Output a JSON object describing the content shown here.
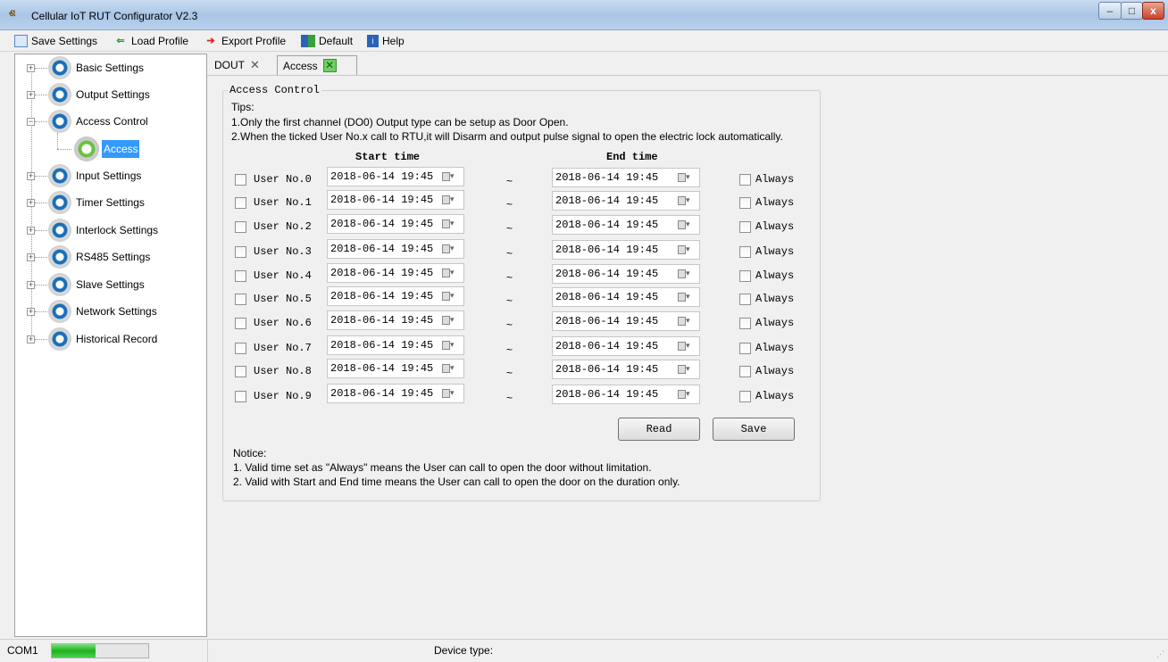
{
  "window": {
    "title": "Cellular IoT RUT Configurator V2.3",
    "min": "–",
    "max": "□",
    "close": "x"
  },
  "menu": [
    {
      "label": "Save Settings",
      "icon": "save-icon"
    },
    {
      "label": "Load Profile",
      "icon": "load-icon"
    },
    {
      "label": "Export Profile",
      "icon": "export-icon"
    },
    {
      "label": "Default",
      "icon": "default-icon"
    },
    {
      "label": "Help",
      "icon": "help-icon"
    }
  ],
  "sidebar": {
    "items": [
      {
        "label": "Basic Settings"
      },
      {
        "label": "Output Settings"
      },
      {
        "label": "Access Control"
      },
      {
        "label": "Access"
      },
      {
        "label": "Input Settings"
      },
      {
        "label": "Timer Settings"
      },
      {
        "label": "Interlock Settings"
      },
      {
        "label": "RS485 Settings"
      },
      {
        "label": "Slave Settings"
      },
      {
        "label": "Network Settings"
      },
      {
        "label": "Historical Record"
      }
    ]
  },
  "tabs": [
    {
      "label": "DOUT",
      "close": "✕"
    },
    {
      "label": "Access",
      "close": "✕"
    }
  ],
  "content": {
    "group_title": "Access Control",
    "tips_title": "Tips:",
    "tip1": "1.Only the first channel (DO0) Output type can be setup as Door Open.",
    "tip2": "2.When the ticked User No.x call to RTU,it will Disarm and output pulse signal to open the electric lock automatically.",
    "start_header": "Start time",
    "end_header": "End time",
    "tilde": "~",
    "always_label": "Always",
    "users": [
      {
        "label": "User No.0",
        "start": "2018-06-14 19:45",
        "end": "2018-06-14 19:45"
      },
      {
        "label": "User No.1",
        "start": "2018-06-14 19:45",
        "end": "2018-06-14 19:45"
      },
      {
        "label": "User No.2",
        "start": "2018-06-14 19:45",
        "end": "2018-06-14 19:45"
      },
      {
        "label": "User No.3",
        "start": "2018-06-14 19:45",
        "end": "2018-06-14 19:45"
      },
      {
        "label": "User No.4",
        "start": "2018-06-14 19:45",
        "end": "2018-06-14 19:45"
      },
      {
        "label": "User No.5",
        "start": "2018-06-14 19:45",
        "end": "2018-06-14 19:45"
      },
      {
        "label": "User No.6",
        "start": "2018-06-14 19:45",
        "end": "2018-06-14 19:45"
      },
      {
        "label": "User No.7",
        "start": "2018-06-14 19:45",
        "end": "2018-06-14 19:45"
      },
      {
        "label": "User No.8",
        "start": "2018-06-14 19:45",
        "end": "2018-06-14 19:45"
      },
      {
        "label": "User No.9",
        "start": "2018-06-14 19:45",
        "end": "2018-06-14 19:45"
      }
    ],
    "read_button": "Read",
    "save_button": "Save",
    "notice_title": "Notice:",
    "notice1": "1. Valid time set as \"Always\" means the User can call to open the door without limitation.",
    "notice2": "2. Valid with Start and End time means the User can call to open the door on the duration only."
  },
  "status": {
    "com_label": "COM1",
    "progress": 0.45,
    "device_type_label": "Device type:"
  },
  "colors": {
    "accent": "#3399ff",
    "progress": "#1fb21f",
    "gear_blue": "#1a6fb8",
    "gear_green": "#6ac03e"
  }
}
